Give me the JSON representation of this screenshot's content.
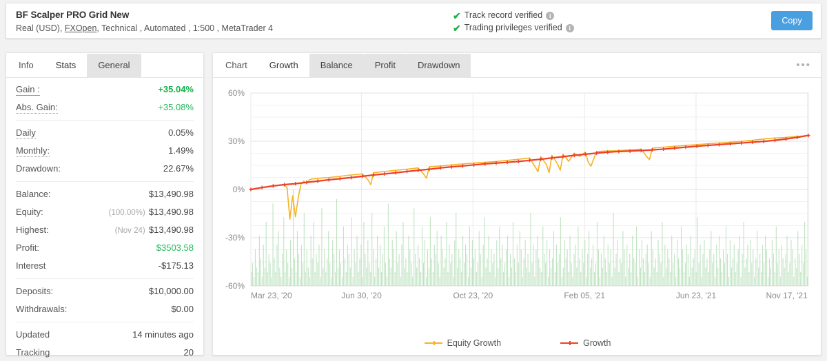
{
  "header": {
    "title": "BF Scalper PRO Grid New",
    "subtitle_prefix": "Real (USD),",
    "broker": "FXOpen",
    "subtitle_suffix": ", Technical , Automated , 1:500 , MetaTrader 4",
    "verify": [
      {
        "label": "Track record verified",
        "info": "i"
      },
      {
        "label": "Trading privileges verified",
        "info": "i"
      }
    ],
    "copy_label": "Copy",
    "accent_color": "#4a9fe0",
    "check_color": "#22b24c"
  },
  "left_panel": {
    "tabs": [
      {
        "label": "Info",
        "state": "plain"
      },
      {
        "label": "Stats",
        "state": "active"
      },
      {
        "label": "General",
        "state": "grey"
      }
    ],
    "groups": [
      {
        "rows": [
          {
            "label": "Gain :",
            "underline": "solid",
            "value": "+35.04%",
            "style": "bold-green"
          },
          {
            "label": "Abs. Gain:",
            "underline": "dotted",
            "value": "+35.08%",
            "style": "green"
          }
        ]
      },
      {
        "rows": [
          {
            "label": "Daily",
            "underline": "dotted",
            "value": "0.05%",
            "style": "plain"
          },
          {
            "label": "Monthly:",
            "underline": "dotted",
            "value": "1.49%",
            "style": "plain"
          },
          {
            "label": "Drawdown:",
            "underline": "none",
            "value": "22.67%",
            "style": "plain"
          }
        ]
      },
      {
        "rows": [
          {
            "label": "Balance:",
            "underline": "none",
            "value": "$13,490.98",
            "style": "plain"
          },
          {
            "label": "Equity:",
            "underline": "none",
            "prefix": "(100.00%)",
            "value": "$13,490.98",
            "style": "plain"
          },
          {
            "label": "Highest:",
            "underline": "none",
            "prefix": "(Nov 24)",
            "value": "$13,490.98",
            "style": "plain"
          },
          {
            "label": "Profit:",
            "underline": "none",
            "value": "$3503.58",
            "style": "green"
          },
          {
            "label": "Interest",
            "underline": "none",
            "value": "-$175.13",
            "style": "plain"
          }
        ]
      },
      {
        "rows": [
          {
            "label": "Deposits:",
            "underline": "none",
            "value": "$10,000.00",
            "style": "plain"
          },
          {
            "label": "Withdrawals:",
            "underline": "none",
            "value": "$0.00",
            "style": "plain"
          }
        ]
      },
      {
        "rows": [
          {
            "label": "Updated",
            "underline": "none",
            "value": "14 minutes ago",
            "style": "plain"
          },
          {
            "label": "Tracking",
            "underline": "none",
            "value": "20",
            "style": "plain"
          }
        ]
      }
    ]
  },
  "chart_panel": {
    "tabs": [
      {
        "label": "Chart",
        "state": "plain"
      },
      {
        "label": "Growth",
        "state": "active"
      },
      {
        "label": "Balance",
        "state": "grey"
      },
      {
        "label": "Profit",
        "state": "grey"
      },
      {
        "label": "Drawdown",
        "state": "grey"
      }
    ],
    "menu_icon": "•••"
  },
  "chart_data": {
    "type": "line",
    "title": "Growth",
    "xlabel": "",
    "ylabel": "",
    "ylim": [
      -60,
      60
    ],
    "yticks": [
      60,
      30,
      0,
      -30,
      -60
    ],
    "ytick_labels": [
      "60%",
      "30%",
      "0%",
      "-30%",
      "-60%"
    ],
    "grid": true,
    "legend_position": "bottom-center",
    "xtick_labels": [
      "Mar 23, '20",
      "Jun 30, '20",
      "Oct 23, '20",
      "Feb 05, '21",
      "Jun 23, '21",
      "Nov 17, '21"
    ],
    "xtick_positions": [
      0,
      0.1985,
      0.3985,
      0.5985,
      0.7985,
      0.9985
    ],
    "series": [
      {
        "name": "Growth",
        "color": "#ec4027",
        "marker": "plus",
        "x": [
          0,
          0.02,
          0.04,
          0.06,
          0.08,
          0.1,
          0.12,
          0.14,
          0.16,
          0.18,
          0.2,
          0.22,
          0.24,
          0.26,
          0.28,
          0.3,
          0.32,
          0.34,
          0.36,
          0.38,
          0.4,
          0.42,
          0.44,
          0.46,
          0.48,
          0.5,
          0.52,
          0.54,
          0.56,
          0.58,
          0.6,
          0.62,
          0.64,
          0.66,
          0.68,
          0.7,
          0.72,
          0.74,
          0.76,
          0.78,
          0.8,
          0.82,
          0.84,
          0.86,
          0.88,
          0.9,
          0.92,
          0.94,
          0.96,
          0.98,
          1.0
        ],
        "values": [
          0.0,
          1.2,
          2.2,
          3.0,
          3.6,
          4.4,
          5.2,
          6.0,
          6.7,
          7.4,
          8.2,
          9.0,
          9.7,
          10.4,
          11.2,
          11.9,
          12.6,
          13.4,
          14.1,
          14.6,
          15.3,
          15.9,
          16.4,
          16.9,
          17.4,
          18.1,
          18.8,
          19.6,
          20.4,
          21.2,
          21.9,
          22.6,
          23.2,
          23.6,
          23.9,
          24.2,
          24.6,
          25.1,
          25.7,
          26.3,
          26.9,
          27.4,
          27.9,
          28.4,
          28.9,
          29.4,
          29.9,
          30.6,
          31.4,
          32.4,
          33.6
        ]
      },
      {
        "name": "Equity Growth",
        "color": "#f5b324",
        "marker": "line",
        "x": [
          0,
          0.02,
          0.04,
          0.06,
          0.065,
          0.07,
          0.075,
          0.08,
          0.085,
          0.09,
          0.095,
          0.1,
          0.105,
          0.11,
          0.12,
          0.14,
          0.16,
          0.18,
          0.2,
          0.21,
          0.215,
          0.22,
          0.24,
          0.26,
          0.28,
          0.3,
          0.31,
          0.315,
          0.32,
          0.34,
          0.36,
          0.38,
          0.4,
          0.42,
          0.44,
          0.46,
          0.48,
          0.5,
          0.51,
          0.515,
          0.52,
          0.53,
          0.535,
          0.54,
          0.55,
          0.555,
          0.56,
          0.57,
          0.58,
          0.59,
          0.6,
          0.605,
          0.61,
          0.62,
          0.64,
          0.66,
          0.68,
          0.7,
          0.71,
          0.715,
          0.72,
          0.74,
          0.76,
          0.78,
          0.8,
          0.82,
          0.84,
          0.86,
          0.88,
          0.9,
          0.92,
          0.94,
          0.96,
          0.98,
          1.0
        ],
        "values": [
          0.0,
          1.2,
          2.2,
          3.0,
          1.0,
          -18.5,
          -4.0,
          -17.0,
          -5.0,
          3.5,
          5.2,
          4.0,
          6.0,
          6.5,
          6.9,
          7.4,
          8.2,
          9.0,
          9.7,
          6.0,
          3.0,
          10.4,
          11.2,
          11.9,
          12.6,
          13.4,
          9.5,
          7.0,
          14.1,
          14.6,
          15.3,
          15.9,
          16.4,
          16.9,
          17.4,
          18.1,
          18.8,
          19.6,
          14.0,
          11.0,
          20.4,
          15.5,
          10.5,
          21.2,
          16.0,
          12.0,
          21.9,
          17.5,
          22.6,
          20.5,
          23.2,
          17.0,
          14.5,
          23.6,
          23.9,
          24.2,
          24.6,
          25.1,
          20.5,
          18.5,
          25.7,
          26.3,
          26.9,
          27.4,
          27.9,
          28.4,
          28.9,
          29.4,
          29.9,
          30.6,
          31.4,
          32.0,
          32.4,
          33.0,
          33.6
        ]
      }
    ],
    "bars": {
      "name": "Volume",
      "color": "#a9d9ac",
      "baseline": -60,
      "max_height": 26,
      "heights": [
        3,
        5,
        2,
        8,
        4,
        3,
        11,
        6,
        2,
        9,
        4,
        14,
        3,
        7,
        5,
        2,
        18,
        6,
        3,
        9,
        12,
        4,
        2,
        7,
        15,
        3,
        8,
        5,
        2,
        10,
        4,
        21,
        6,
        3,
        12,
        7,
        2,
        9,
        5,
        16,
        3,
        8,
        4,
        2,
        11,
        6,
        14,
        3,
        7,
        5,
        9,
        2,
        17,
        4,
        8,
        3,
        6,
        12,
        5,
        2,
        10,
        7,
        3,
        19,
        4,
        8,
        5,
        2,
        13,
        6,
        3,
        9,
        7,
        4,
        15,
        2,
        8,
        5,
        11,
        3,
        6,
        9,
        2,
        14,
        7,
        4,
        10,
        5,
        3,
        16,
        8,
        2,
        6,
        11,
        4,
        9,
        3,
        7,
        13,
        5,
        2,
        18,
        6,
        4,
        10,
        8,
        3,
        12,
        5,
        7,
        2,
        9,
        14,
        4,
        6,
        3,
        11,
        8,
        5,
        2,
        17,
        7,
        4,
        9,
        6,
        3,
        13,
        5,
        10,
        2,
        8,
        4,
        15,
        6,
        3,
        9,
        7,
        12,
        5,
        2,
        11,
        8,
        4,
        6,
        14,
        3,
        9,
        5,
        7,
        2,
        10,
        16,
        4,
        8,
        6,
        3,
        11,
        5,
        9,
        7,
        2,
        13,
        4,
        10,
        6,
        8,
        3,
        5,
        12,
        7,
        2,
        9,
        15,
        4,
        6,
        11,
        3,
        8,
        5,
        7,
        2,
        10,
        4,
        13,
        6,
        9,
        3,
        5,
        8,
        11,
        2,
        7,
        4,
        14,
        6,
        3,
        9,
        5,
        12,
        8,
        2,
        6,
        10,
        4,
        7,
        3,
        16,
        5,
        9,
        2,
        8,
        11,
        6,
        4,
        3,
        13,
        7,
        5,
        10,
        2,
        8,
        4,
        6,
        12,
        3,
        9,
        5,
        7,
        15,
        2,
        4,
        10,
        6,
        8,
        3,
        11,
        5,
        2,
        7,
        9,
        4,
        13,
        6,
        3,
        8,
        5,
        10,
        2,
        7,
        12,
        4,
        6,
        9,
        3,
        5,
        14,
        8,
        2,
        7,
        4,
        11,
        6,
        3,
        9,
        5,
        8,
        2,
        16,
        4,
        7,
        10,
        3,
        6,
        5,
        12,
        8,
        2,
        9,
        4,
        7,
        3,
        11,
        6,
        5,
        13,
        2,
        8,
        4,
        10,
        6,
        3,
        7,
        9,
        5,
        2,
        12,
        8,
        4,
        6,
        3,
        10,
        7,
        5,
        14,
        2,
        9,
        4,
        8,
        6,
        3,
        11,
        5,
        7,
        2,
        10,
        6,
        4,
        13,
        8,
        3,
        5,
        9,
        7,
        2,
        11,
        4,
        6,
        8,
        3,
        15,
        5,
        9,
        2,
        7,
        10,
        4,
        6,
        3,
        8,
        12,
        5,
        7,
        2,
        9,
        4,
        11,
        6,
        3,
        8,
        5,
        13,
        7,
        2,
        10,
        4,
        6,
        9,
        3,
        5,
        8,
        11,
        2,
        7,
        14,
        4,
        6,
        9,
        3,
        10,
        5,
        8,
        2,
        6,
        12,
        4,
        7,
        3,
        9,
        5,
        11,
        8,
        2,
        6,
        4,
        10,
        7,
        3,
        13,
        5,
        8,
        2,
        9,
        6,
        4,
        7,
        11,
        3,
        5,
        10,
        8,
        2,
        6,
        4,
        12,
        7,
        3,
        9,
        5,
        14,
        8,
        2
      ]
    }
  }
}
